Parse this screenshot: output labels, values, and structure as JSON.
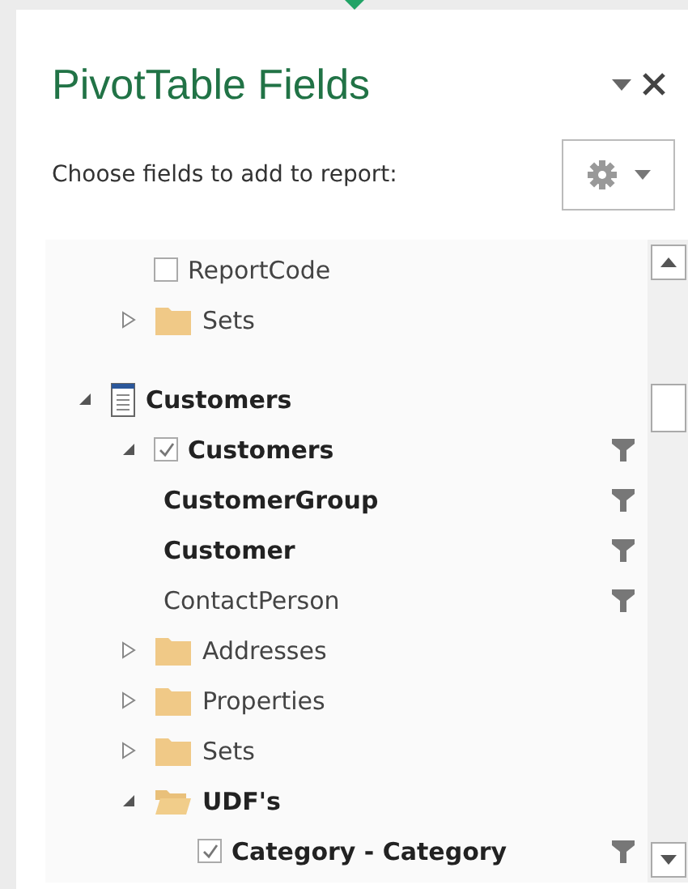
{
  "panel": {
    "title": "PivotTable Fields",
    "subtitle": "Choose fields to add to report:"
  },
  "tree": [
    {
      "kind": "group",
      "children": [
        {
          "kind": "field",
          "label": "ReportCode",
          "checked": false,
          "active": false,
          "filtered": false
        },
        {
          "kind": "folder",
          "label": "Sets",
          "expanded": false,
          "active": false
        }
      ]
    },
    {
      "kind": "table",
      "label": "Customers",
      "expanded": true,
      "active": true,
      "children": [
        {
          "kind": "hierarchy",
          "label": "Customers",
          "checked": true,
          "expanded": true,
          "active": true,
          "filtered": true,
          "children": [
            {
              "kind": "level",
              "label": "CustomerGroup",
              "active": true,
              "filtered": true
            },
            {
              "kind": "level",
              "label": "Customer",
              "active": true,
              "filtered": true
            },
            {
              "kind": "level",
              "label": "ContactPerson",
              "active": false,
              "filtered": true
            }
          ]
        },
        {
          "kind": "folder",
          "label": "Addresses",
          "expanded": false,
          "active": false
        },
        {
          "kind": "folder",
          "label": "Properties",
          "expanded": false,
          "active": false
        },
        {
          "kind": "folder",
          "label": "Sets",
          "expanded": false,
          "active": false
        },
        {
          "kind": "folder",
          "label": "UDF's",
          "expanded": true,
          "active": true,
          "children": [
            {
              "kind": "field",
              "label": "Category - Category",
              "checked": true,
              "active": true,
              "filtered": true
            }
          ]
        }
      ]
    }
  ]
}
